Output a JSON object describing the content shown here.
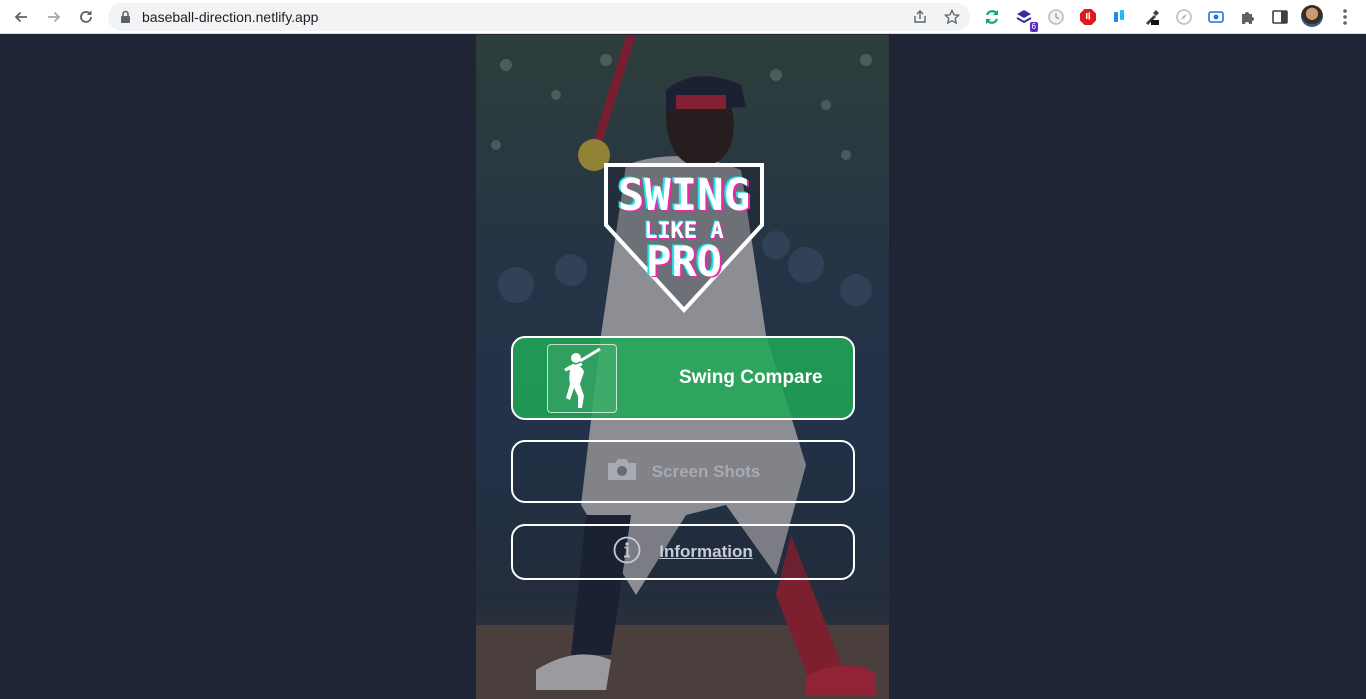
{
  "browser": {
    "url": "baseball-direction.netlify.app",
    "extension_badge": "6",
    "icons": [
      "back-icon",
      "forward-icon",
      "reload-icon",
      "lock-icon",
      "share-icon",
      "star-icon",
      "sync-extension-icon",
      "stack-extension-icon",
      "timer-extension-icon",
      "ad-block-extension-icon",
      "wave-extension-icon",
      "eyedropper-extension-icon",
      "compass-extension-icon",
      "screen-record-extension-icon",
      "puzzle-icon",
      "side-panel-icon",
      "kebab-menu-icon"
    ]
  },
  "app": {
    "logo": {
      "line1": "SWING",
      "line2": "LIKE A",
      "line3": "PRO"
    },
    "buttons": {
      "compare_label": "Swing Compare",
      "screenshots_label": "Screen Shots",
      "information_label": "Information"
    },
    "colors": {
      "page_background": "#1f2535",
      "compare_button": "#20a855",
      "logo_cyan": "#24e3f0",
      "logo_magenta": "#e72aa8"
    }
  }
}
